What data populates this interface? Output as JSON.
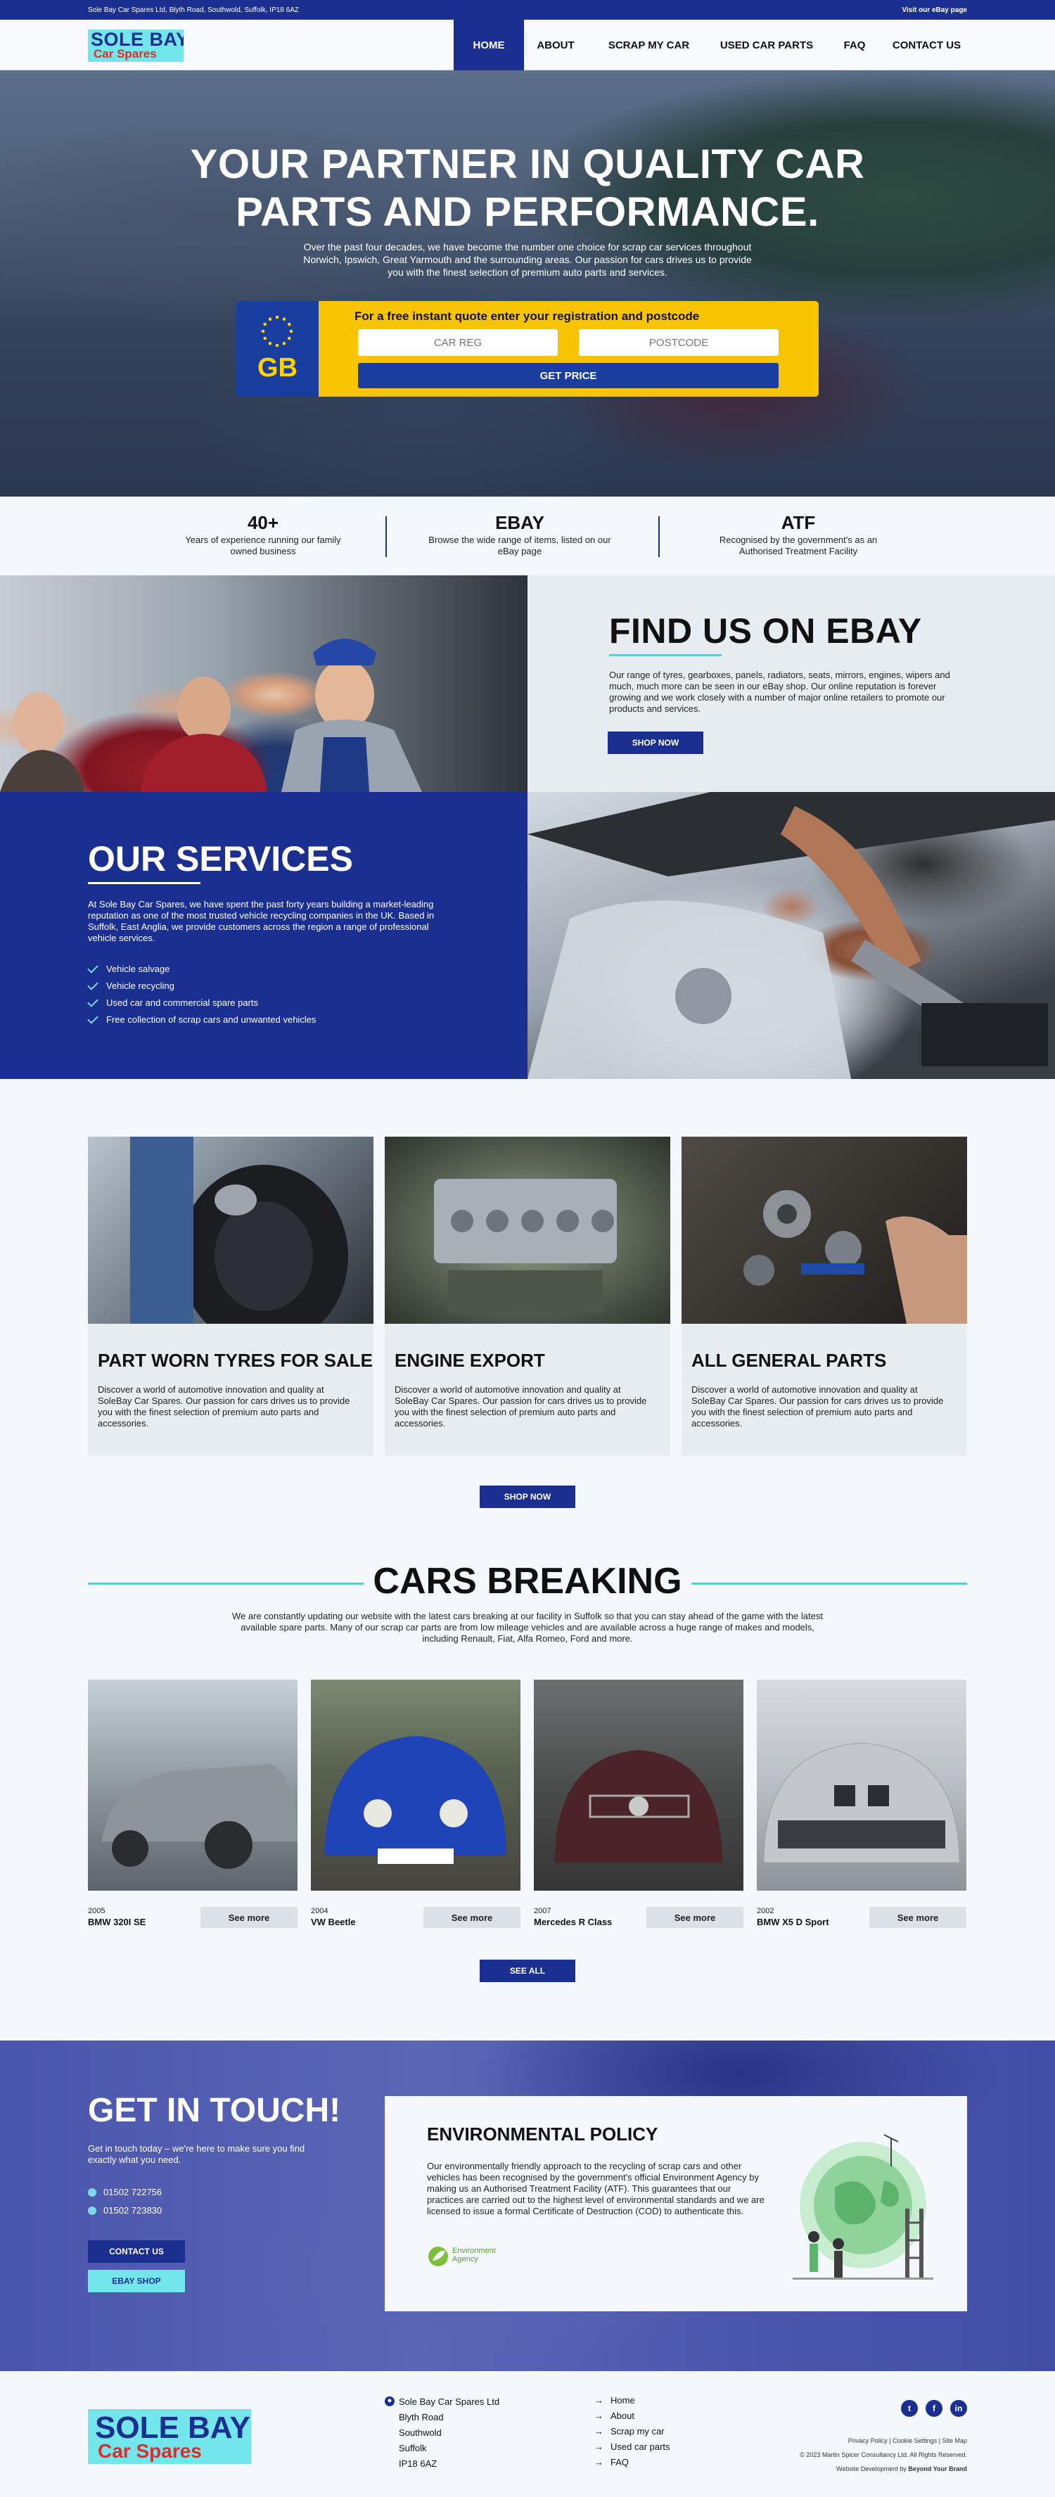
{
  "topbar": {
    "address": "Sole Bay Car Spares Ltd, Blyth Road, Southwold, Suffolk, IP18 6AZ",
    "ebay_link": "Visit our eBay page"
  },
  "brand": {
    "line1": "SOLE BAY",
    "line2": "Car Spares"
  },
  "nav": [
    "HOME",
    "ABOUT",
    "SCRAP MY CAR",
    "USED CAR PARTS",
    "FAQ",
    "CONTACT US"
  ],
  "hero": {
    "title_line1": "YOUR PARTNER IN QUALITY CAR",
    "title_line2": "PARTS AND PERFORMANCE.",
    "subtitle": "Over the past four decades, we have become the number one choice for scrap car services throughout Norwich, Ipswich, Great Yarmouth and the surrounding areas. Our passion for cars drives us to provide you with the finest selection of premium auto parts and services.",
    "quote_label": "For a free instant quote enter your registration and postcode",
    "plate_country": "GB",
    "reg_placeholder": "CAR REG",
    "postcode_placeholder": "POSTCODE",
    "button": "GET PRICE"
  },
  "stats": [
    {
      "big": "40+",
      "small": "Years of experience running our family owned business"
    },
    {
      "big": "EBAY",
      "small": "Browse the wide range of items, listed on our eBay page"
    },
    {
      "big": "ATF",
      "small": "Recognised by the government's as an Authorised Treatment Facility"
    }
  ],
  "ebay": {
    "title": "FIND US ON EBAY",
    "text": "Our range of tyres, gearboxes, panels, radiators, seats, mirrors, engines, wipers and much, much more can be seen in our eBay shop. Our online reputation is forever growing and we work closely with a number of major online retailers to promote our products and services.",
    "button": "SHOP NOW"
  },
  "services": {
    "title": "OUR SERVICES",
    "text": "At Sole Bay Car Spares, we have spent the past forty years building a market-leading reputation as one of the most trusted vehicle recycling companies in the UK. Based in Suffolk, East Anglia, we provide customers across the region a range of professional vehicle services.",
    "items": [
      "Vehicle salvage",
      "Vehicle recycling",
      "Used car and commercial spare parts",
      "Free collection of scrap cars and unwanted vehicles"
    ]
  },
  "cards": [
    {
      "title": "PART WORN TYRES FOR SALE",
      "text": "Discover a world of automotive innovation and quality at SoleBay Car Spares. Our passion for cars drives us to provide you with the finest selection of premium auto parts and accessories."
    },
    {
      "title": "ENGINE EXPORT",
      "text": "Discover a world of automotive innovation and quality at SoleBay Car Spares. Our passion for cars drives us to provide you with the finest selection of premium auto parts and accessories."
    },
    {
      "title": "ALL GENERAL PARTS",
      "text": "Discover a world of automotive innovation and quality at SoleBay Car Spares. Our passion for cars drives us to provide you with the finest selection of premium auto parts and accessories."
    }
  ],
  "cards_button": "SHOP NOW",
  "breaking": {
    "title": "CARS BREAKING",
    "text": "We are constantly updating our website with the latest cars breaking at our facility in Suffolk so that you can stay ahead of the game with the latest available spare parts. Many of our scrap car parts are from low mileage vehicles and are available across a huge range of makes and models, including Renault, Fiat, Alfa Romeo, Ford and more.",
    "cars": [
      {
        "year": "2005",
        "name": "BMW 320I SE",
        "button": "See more"
      },
      {
        "year": "2004",
        "name": "VW Beetle",
        "button": "See more"
      },
      {
        "year": "2007",
        "name": "Mercedes R Class",
        "button": "See more"
      },
      {
        "year": "2002",
        "name": "BMW X5 D Sport",
        "button": "See more"
      }
    ],
    "button": "SEE ALL"
  },
  "touch": {
    "title": "GET IN TOUCH!",
    "text": "Get in touch today – we're here to make sure you find exactly what you need.",
    "phones": [
      "01502 722756",
      "01502 723830"
    ],
    "contact_button": "CONTACT US",
    "ebay_button": "EBAY SHOP"
  },
  "env": {
    "title": "ENVIRONMENTAL POLICY",
    "text": "Our environmentally friendly approach to the recycling of scrap cars and other vehicles has been recognised by the government's official Environment Agency by making us an Authorised Treatment Facility (ATF). This guarantees that our practices are carried out to the highest level of environmental standards and we are licensed to issue a formal Certificate of Destruction (COD) to authenticate this.",
    "agency_logo_text": "Environment Agency"
  },
  "footer": {
    "address": [
      "Sole Bay Car Spares Ltd",
      "Blyth Road",
      "Southwold",
      "Suffolk",
      "IP18 6AZ"
    ],
    "links": [
      "Home",
      "About",
      "Scrap my car",
      "Used car parts",
      "FAQ"
    ],
    "social": [
      "t",
      "f",
      "in"
    ],
    "legal_links": "Privacy Policy  |  Cookie Settings  |  Site Map",
    "copyright": "© 2023 Martin Spicer Consultancy Ltd. All Rights Reserved.",
    "dev_prefix": "Website Development by",
    "dev_name": "Beyond Your Brand"
  },
  "colors": {
    "primary": "#1a2f8f",
    "accent": "#73e6ec",
    "plate": "#f8c300",
    "red": "#e02b2b"
  }
}
